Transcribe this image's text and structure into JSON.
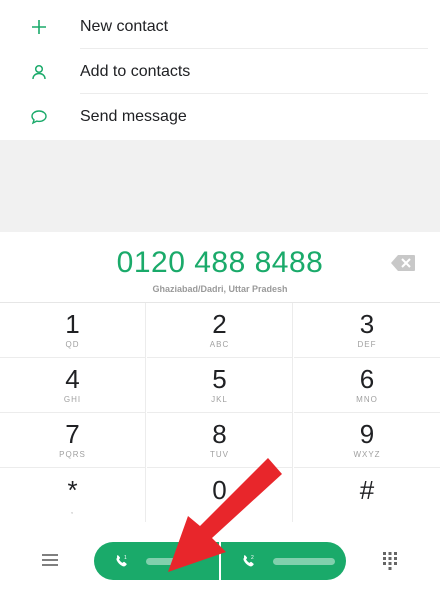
{
  "actions": [
    {
      "label": "New contact",
      "icon": "plus-icon"
    },
    {
      "label": "Add to contacts",
      "icon": "person-icon"
    },
    {
      "label": "Send message",
      "icon": "message-bubble-icon"
    }
  ],
  "dialer": {
    "number": "0120 488 8488",
    "location": "Ghaziabad/Dadri, Uttar Pradesh"
  },
  "keypad": [
    {
      "digit": "1",
      "letters": "QD"
    },
    {
      "digit": "2",
      "letters": "ABC"
    },
    {
      "digit": "3",
      "letters": "DEF"
    },
    {
      "digit": "4",
      "letters": "GHI"
    },
    {
      "digit": "5",
      "letters": "JKL"
    },
    {
      "digit": "6",
      "letters": "MNO"
    },
    {
      "digit": "7",
      "letters": "PQRS"
    },
    {
      "digit": "8",
      "letters": "TUV"
    },
    {
      "digit": "9",
      "letters": "WXYZ"
    },
    {
      "digit": "*",
      "letters": ","
    },
    {
      "digit": "0",
      "letters": "+"
    },
    {
      "digit": "#",
      "letters": ""
    }
  ],
  "colors": {
    "accent": "#1aaa6a",
    "arrow": "#e8262b"
  }
}
